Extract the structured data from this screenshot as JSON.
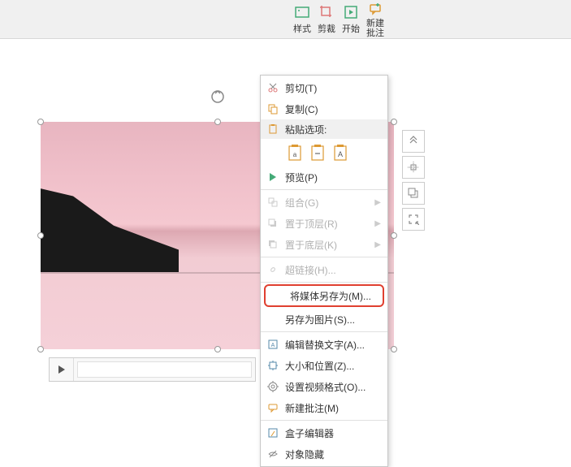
{
  "ribbon": {
    "style": "样式",
    "crop": "剪裁",
    "start": "开始",
    "new_comment": "新建批注"
  },
  "sideTools": {
    "collapse": "⌃",
    "align": "◈",
    "arrange": "◳",
    "fullscreen": "⛶"
  },
  "contextMenu": {
    "cut": "剪切(T)",
    "copy": "复制(C)",
    "paste_options": "粘贴选项:",
    "preview": "预览(P)",
    "group": "组合(G)",
    "bring_front": "置于顶层(R)",
    "send_back": "置于底层(K)",
    "hyperlink": "超链接(H)...",
    "save_media_as": "将媒体另存为(M)...",
    "save_as_picture": "另存为图片(S)...",
    "alt_text": "编辑替换文字(A)...",
    "size_position": "大小和位置(Z)...",
    "video_format": "设置视频格式(O)...",
    "new_comment": "新建批注(M)",
    "box_editor": "盒子编辑器",
    "hide_object": "对象隐藏"
  }
}
